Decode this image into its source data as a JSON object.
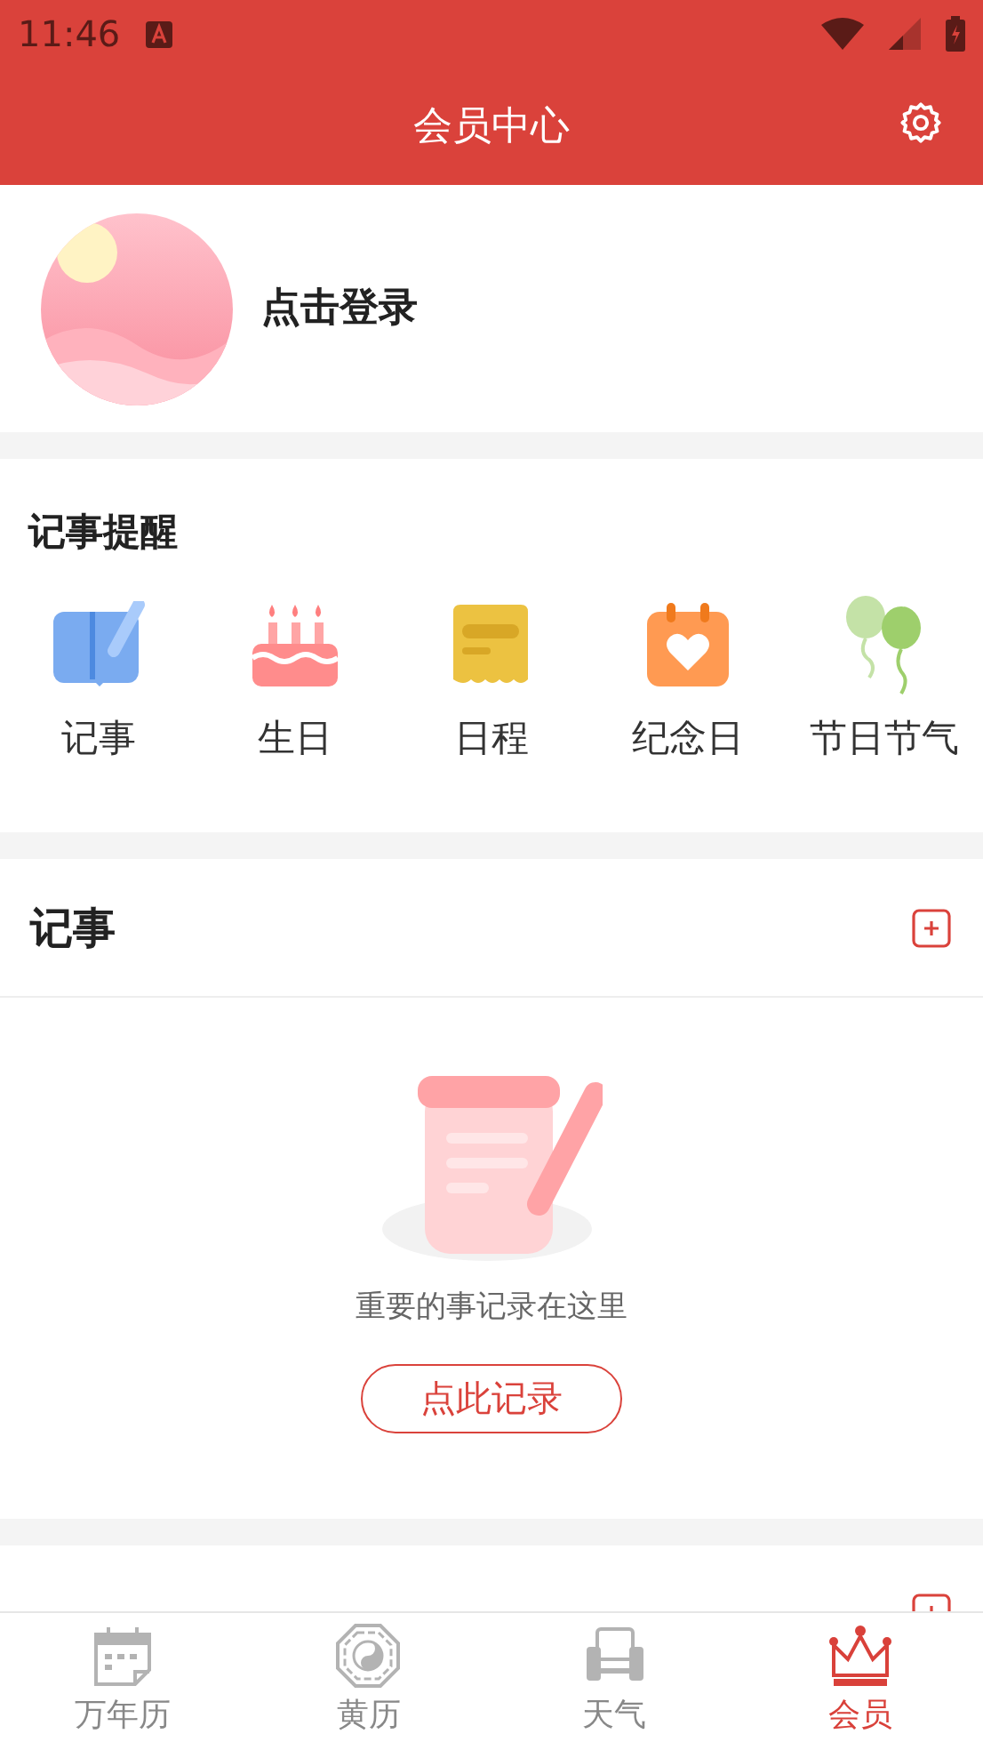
{
  "status_bar": {
    "time": "11:46"
  },
  "header": {
    "title": "会员中心"
  },
  "profile": {
    "login_label": "点击登录"
  },
  "reminders": {
    "title": "记事提醒",
    "items": [
      {
        "kind": "note",
        "label": "记事"
      },
      {
        "kind": "birthday",
        "label": "生日"
      },
      {
        "kind": "schedule",
        "label": "日程"
      },
      {
        "kind": "anniversary",
        "label": "纪念日"
      },
      {
        "kind": "festival",
        "label": "节日节气"
      }
    ]
  },
  "notes": {
    "title": "记事",
    "empty_text": "重要的事记录在这里",
    "action": "点此记录"
  },
  "tabs": [
    {
      "kind": "calendar",
      "label": "万年历",
      "selected": false
    },
    {
      "kind": "almanac",
      "label": "黄历",
      "selected": false
    },
    {
      "kind": "weather",
      "label": "天气",
      "selected": false
    },
    {
      "kind": "member",
      "label": "会员",
      "selected": true
    }
  ]
}
